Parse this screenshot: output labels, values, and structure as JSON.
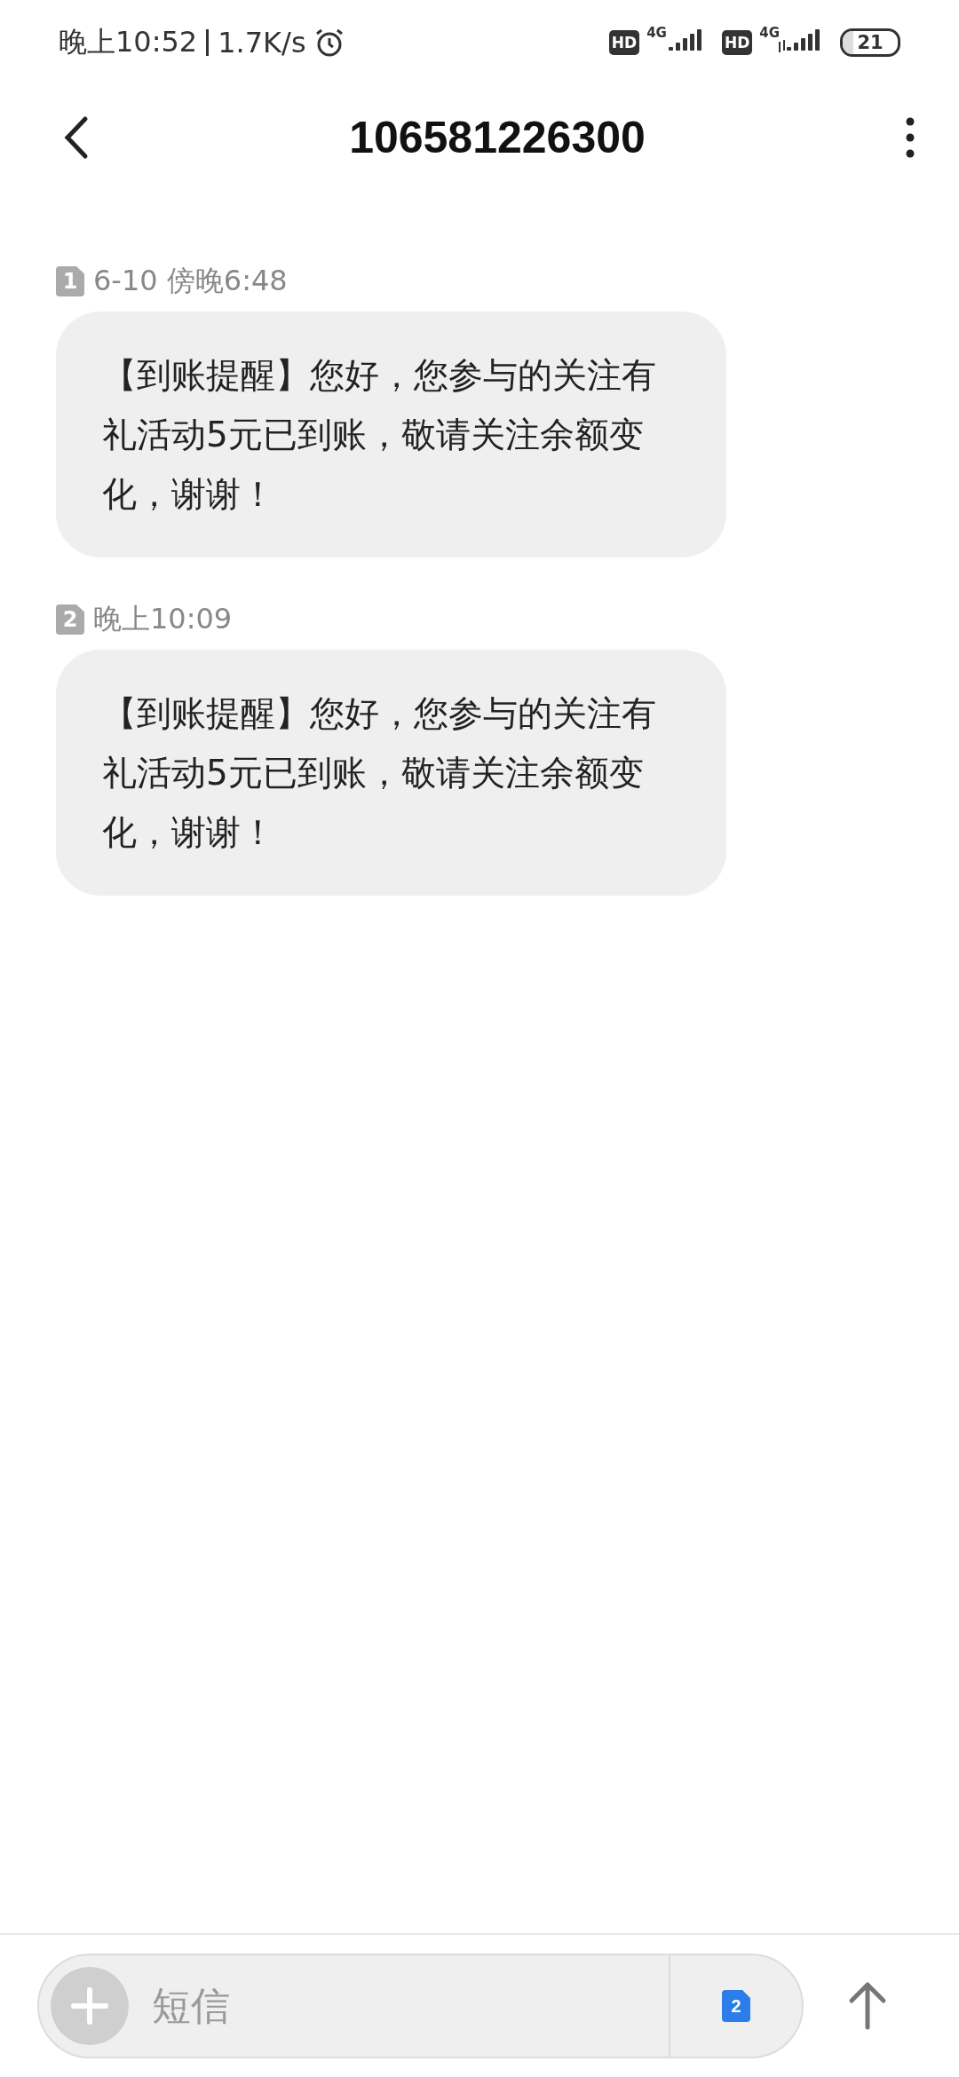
{
  "status_bar": {
    "time": "晚上10:52",
    "speed": "1.7K/s",
    "sims": [
      {
        "hd": "HD",
        "network": "4G",
        "data_arrows": false
      },
      {
        "hd": "HD",
        "network": "4G",
        "data_arrows": true
      }
    ],
    "battery": "21"
  },
  "header": {
    "title": "106581226300"
  },
  "messages": [
    {
      "sim": "1",
      "time": "6-10 傍晚6:48",
      "text": "【到账提醒】您好，您参与的关注有礼活动5元已到账，敬请关注余额变化，谢谢！"
    },
    {
      "sim": "2",
      "time": "晚上10:09",
      "text": "【到账提醒】您好，您参与的关注有礼活动5元已到账，敬请关注余额变化，谢谢！"
    }
  ],
  "composer": {
    "placeholder": "短信",
    "sim": "2"
  }
}
